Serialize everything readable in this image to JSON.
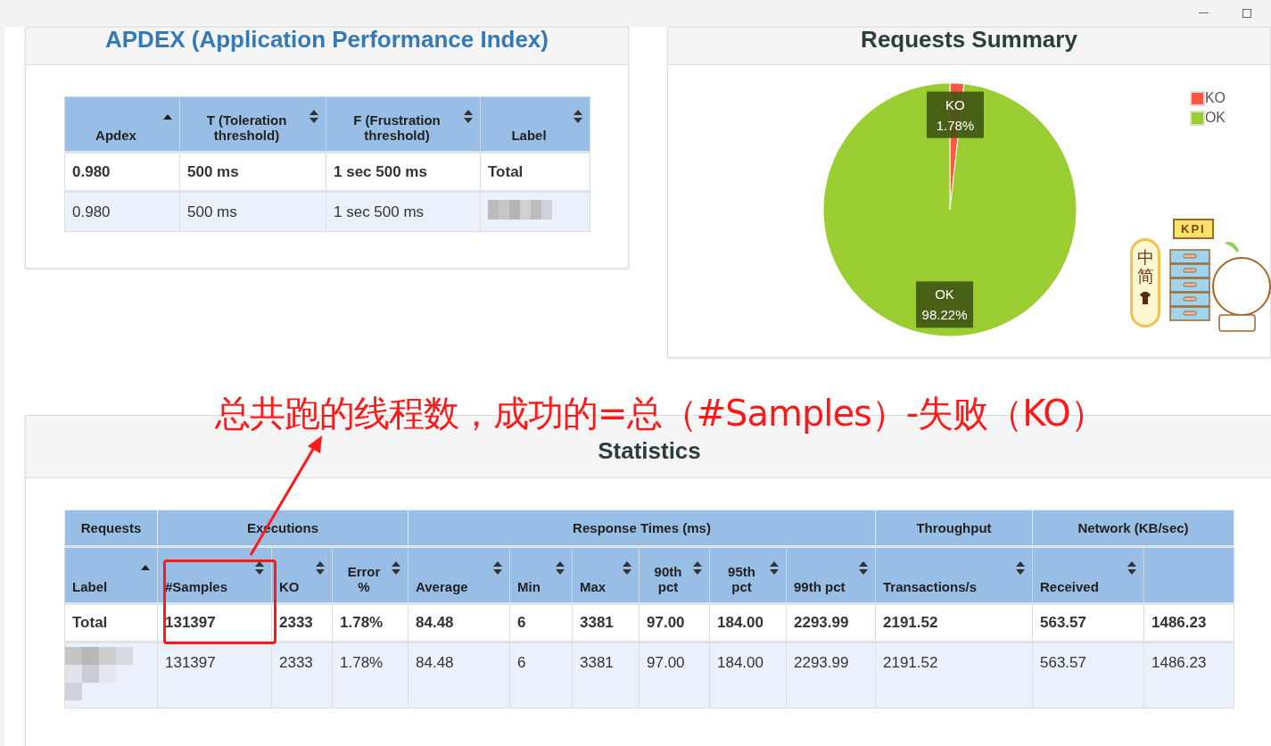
{
  "apdex": {
    "title": "APDEX (Application Performance Index)",
    "columns": [
      {
        "label": "Apdex",
        "sorted": true
      },
      {
        "label": "T (Toleration threshold)",
        "sorted": false
      },
      {
        "label": "F (Frustration threshold)",
        "sorted": false
      },
      {
        "label": "Label",
        "sorted": false
      }
    ],
    "rows": [
      {
        "kind": "total",
        "cells": [
          "0.980",
          "500 ms",
          "1 sec 500 ms",
          "Total"
        ]
      },
      {
        "kind": "item",
        "cells": [
          "0.980",
          "500 ms",
          "1 sec 500 ms",
          null
        ]
      }
    ]
  },
  "summary": {
    "title": "Requests Summary",
    "chart_data": {
      "type": "pie",
      "categories": [
        "KO",
        "OK"
      ],
      "values": [
        1.78,
        98.22
      ],
      "value_labels": [
        "1.78%",
        "98.22%"
      ]
    },
    "legend": [
      {
        "label": "KO",
        "color": "#fe5845"
      },
      {
        "label": "OK",
        "color": "#9acd32"
      }
    ]
  },
  "annotation": {
    "text": "总共跑的线程数，成功的=总（#Samples）-失败（KO）"
  },
  "statistics": {
    "title": "Statistics",
    "column_groups": [
      {
        "label": "Requests",
        "columns": [
          {
            "label": "Label",
            "sorted": true
          }
        ]
      },
      {
        "label": "Executions",
        "columns": [
          {
            "label": "#Samples",
            "sorted": false
          },
          {
            "label": "KO",
            "sorted": false
          },
          {
            "label": "Error %",
            "sorted": false
          }
        ]
      },
      {
        "label": "Response Times (ms)",
        "columns": [
          {
            "label": "Average",
            "sorted": false
          },
          {
            "label": "Min",
            "sorted": false
          },
          {
            "label": "Max",
            "sorted": false
          },
          {
            "label": "90th pct",
            "sorted": false
          },
          {
            "label": "95th pct",
            "sorted": false
          },
          {
            "label": "99th pct",
            "sorted": false
          }
        ]
      },
      {
        "label": "Throughput",
        "columns": [
          {
            "label": "Transactions/s",
            "sorted": false
          }
        ]
      },
      {
        "label": "Network (KB/sec)",
        "columns": [
          {
            "label": "Received",
            "sorted": false
          },
          {}
        ]
      }
    ],
    "rows": [
      {
        "kind": "total",
        "cells": [
          "Total",
          "131397",
          "2333",
          "1.78%",
          "84.48",
          "6",
          "3381",
          "97.00",
          "184.00",
          "2293.99",
          "2191.52",
          "563.57",
          "1486.23"
        ]
      },
      {
        "kind": "item",
        "cells": [
          null,
          "131397",
          "2333",
          "1.78%",
          "84.48",
          "6",
          "3381",
          "97.00",
          "184.00",
          "2293.99",
          "2191.52",
          "563.57",
          "1486.23"
        ]
      }
    ]
  },
  "ime_widget": {
    "mode": [
      "中",
      "简"
    ],
    "sign": "KPI"
  }
}
